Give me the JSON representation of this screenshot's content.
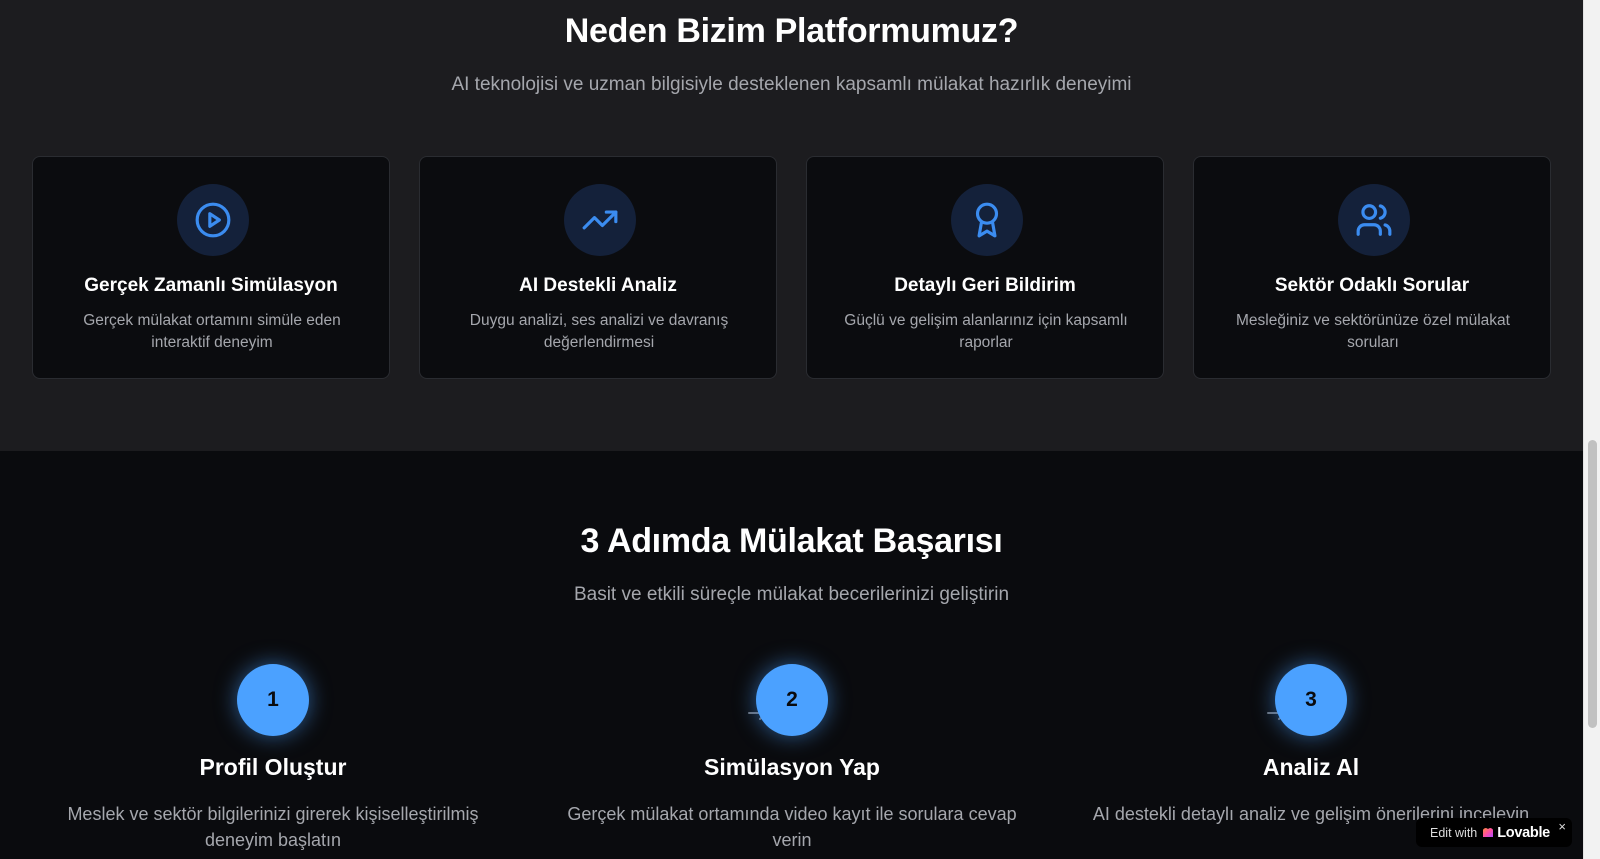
{
  "features": {
    "title": "Neden Bizim Platformumuz?",
    "subtitle": "AI teknolojisi ve uzman bilgisiyle desteklenen kapsamlı mülakat hazırlık deneyimi",
    "cards": [
      {
        "icon": "play-circle-icon",
        "title": "Gerçek Zamanlı Simülasyon",
        "description": "Gerçek mülakat ortamını simüle eden interaktif deneyim"
      },
      {
        "icon": "trending-up-icon",
        "title": "AI Destekli Analiz",
        "description": "Duygu analizi, ses analizi ve davranış değerlendirmesi"
      },
      {
        "icon": "award-icon",
        "title": "Detaylı Geri Bildirim",
        "description": "Güçlü ve gelişim alanlarınız için kapsamlı raporlar"
      },
      {
        "icon": "users-icon",
        "title": "Sektör Odaklı Sorular",
        "description": "Mesleğiniz ve sektörünüze özel mülakat soruları"
      }
    ]
  },
  "steps": {
    "title": "3 Adımda Mülakat Başarısı",
    "subtitle": "Basit ve etkili süreçle mülakat becerilerinizi geliştirin",
    "items": [
      {
        "number": "1",
        "title": "Profil Oluştur",
        "description": "Meslek ve sektör bilgilerinizi girerek kişiselleştirilmiş deneyim başlatın"
      },
      {
        "number": "2",
        "title": "Simülasyon Yap",
        "description": "Gerçek mülakat ortamında video kayıt ile sorulara cevap verin"
      },
      {
        "number": "3",
        "title": "Analiz Al",
        "description": "AI destekli detaylı analiz ve gelişim önerilerini inceleyin"
      }
    ]
  },
  "badge": {
    "prefix": "Edit with",
    "brand": "Lovable",
    "close": "×"
  },
  "colors": {
    "accent": "#4ba1ff",
    "icon_blue": "#3b8cf0",
    "section_dark": "#1c1c1f",
    "section_darker": "#0a0b0e"
  }
}
